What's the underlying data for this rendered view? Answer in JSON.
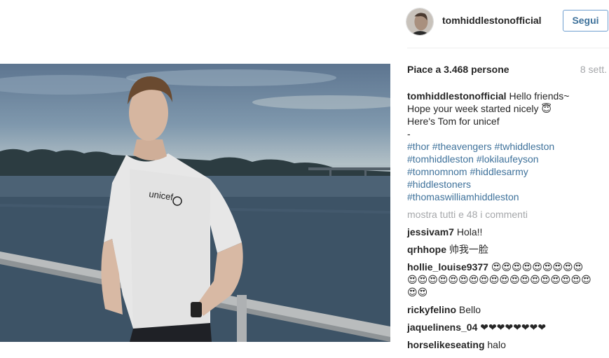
{
  "post": {
    "username": "tomhiddlestonofficial",
    "follow_label": "Segui",
    "likes": "Piace a 3.468 persone",
    "time": "8 sett.",
    "caption_lines": [
      "Hello friends~",
      "Hope your week started nicely 😇",
      "Here's Tom for unicef",
      "-"
    ],
    "hashtag_lines": [
      "#thor #theavengers #twhiddleston",
      "#tomhiddleston #lokilaufeyson",
      "#tomnomnom #hiddlesarmy",
      "#hiddlestoners",
      "#thomaswilliamhiddleston"
    ],
    "more_comments": "mostra tutti e 48 i commenti",
    "shirt_text": "unicef"
  },
  "comments": [
    {
      "user": "jessivam7",
      "text": "Hola!!"
    },
    {
      "user": "qrhhope",
      "text": "帅我一脸"
    },
    {
      "user": "hollie_louise9377",
      "text": "😍😍😍😍😍😍😍😍😍"
    },
    {
      "user": "",
      "text": "😍😍😍😍😍😍😍😍😍😍😍😍😍😍😍😍😍😍"
    },
    {
      "user": "",
      "text": "😍😍"
    },
    {
      "user": "rickyfelino",
      "text": "Bello"
    },
    {
      "user": "jaquelinens_04",
      "text": "❤❤❤❤❤❤❤❤"
    },
    {
      "user": "horselikeseating",
      "text": "halo"
    }
  ],
  "colors": {
    "link": "#3f729b",
    "muted": "#a5a7aa",
    "text": "#262626",
    "follow_border": "#70a0d0"
  }
}
